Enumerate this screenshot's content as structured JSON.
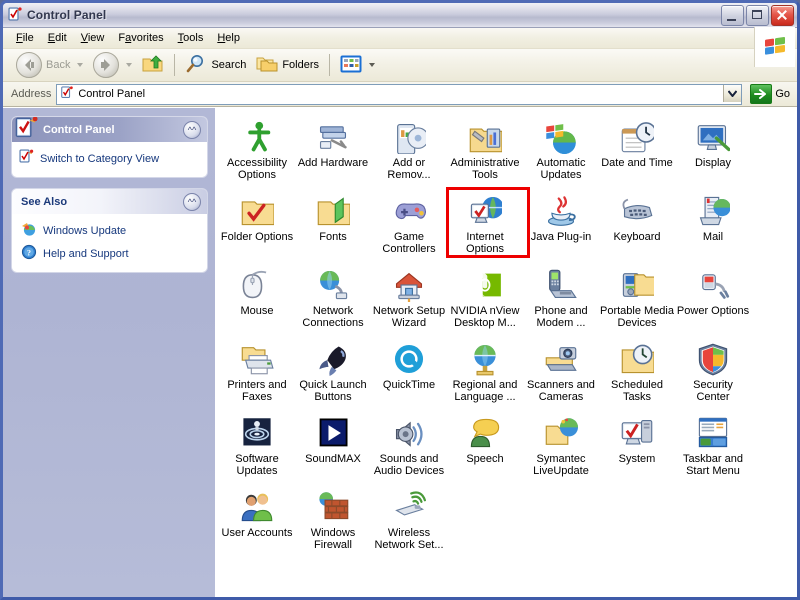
{
  "window": {
    "title": "Control Panel",
    "title_icon": "control-panel-icon",
    "buttons": {
      "minimize": "Minimize",
      "maximize": "Maximize",
      "close": "Close"
    }
  },
  "menubar": {
    "items": [
      {
        "label": "File",
        "accel": "F"
      },
      {
        "label": "Edit",
        "accel": "E"
      },
      {
        "label": "View",
        "accel": "V"
      },
      {
        "label": "Favorites",
        "accel": "a"
      },
      {
        "label": "Tools",
        "accel": "T"
      },
      {
        "label": "Help",
        "accel": "H"
      }
    ],
    "brand_icon": "windows-flag-icon"
  },
  "toolbar": {
    "back_label": "Back",
    "back_icon": "back-arrow-icon",
    "back_disabled": true,
    "forward_icon": "forward-arrow-icon",
    "forward_disabled": true,
    "up_icon": "up-folder-icon",
    "search_label": "Search",
    "search_icon": "magnifier-icon",
    "folders_label": "Folders",
    "folders_icon": "folders-icon",
    "views_icon": "views-icon"
  },
  "address": {
    "label": "Address",
    "value": "Control Panel",
    "icon": "control-panel-icon",
    "dropdown_icon": "chevron-down-icon",
    "go_label": "Go",
    "go_icon": "go-arrow-icon"
  },
  "sidebar": {
    "panels": [
      {
        "title": "Control Panel",
        "style": "blue",
        "head_icon": "control-panel-icon",
        "collapse_icon": "chevron-up-icon",
        "links": [
          {
            "label": "Switch to Category View",
            "icon": "category-view-icon"
          }
        ]
      },
      {
        "title": "See Also",
        "style": "white",
        "collapse_icon": "chevron-up-icon",
        "links": [
          {
            "label": "Windows Update",
            "icon": "windows-update-icon"
          },
          {
            "label": "Help and Support",
            "icon": "help-icon"
          }
        ]
      }
    ]
  },
  "main": {
    "selected_item": "Internet Options",
    "selection_color": "#ee0000",
    "items": [
      {
        "label": "Accessibility Options",
        "icon": "accessibility-icon"
      },
      {
        "label": "Add Hardware",
        "icon": "add-hardware-icon"
      },
      {
        "label": "Add or Remov...",
        "icon": "add-remove-programs-icon"
      },
      {
        "label": "Administrative Tools",
        "icon": "administrative-tools-icon"
      },
      {
        "label": "Automatic Updates",
        "icon": "automatic-updates-icon"
      },
      {
        "label": "Date and Time",
        "icon": "date-time-icon"
      },
      {
        "label": "Display",
        "icon": "display-icon"
      },
      {
        "label": "Folder Options",
        "icon": "folder-options-icon"
      },
      {
        "label": "Fonts",
        "icon": "fonts-icon"
      },
      {
        "label": "Game Controllers",
        "icon": "game-controllers-icon"
      },
      {
        "label": "Internet Options",
        "icon": "internet-options-icon"
      },
      {
        "label": "Java Plug-in",
        "icon": "java-icon"
      },
      {
        "label": "Keyboard",
        "icon": "keyboard-icon"
      },
      {
        "label": "Mail",
        "icon": "mail-icon"
      },
      {
        "label": "Mouse",
        "icon": "mouse-icon"
      },
      {
        "label": "Network Connections",
        "icon": "network-connections-icon"
      },
      {
        "label": "Network Setup Wizard",
        "icon": "network-setup-icon"
      },
      {
        "label": "NVIDIA nView Desktop M...",
        "icon": "nvidia-icon"
      },
      {
        "label": "Phone and Modem ...",
        "icon": "phone-modem-icon"
      },
      {
        "label": "Portable Media Devices",
        "icon": "portable-media-icon"
      },
      {
        "label": "Power Options",
        "icon": "power-options-icon"
      },
      {
        "label": "Printers and Faxes",
        "icon": "printers-faxes-icon"
      },
      {
        "label": "Quick Launch Buttons",
        "icon": "quick-launch-icon"
      },
      {
        "label": "QuickTime",
        "icon": "quicktime-icon"
      },
      {
        "label": "Regional and Language ...",
        "icon": "regional-language-icon"
      },
      {
        "label": "Scanners and Cameras",
        "icon": "scanners-cameras-icon"
      },
      {
        "label": "Scheduled Tasks",
        "icon": "scheduled-tasks-icon"
      },
      {
        "label": "Security Center",
        "icon": "security-center-icon"
      },
      {
        "label": "Software Updates",
        "icon": "software-updates-icon"
      },
      {
        "label": "SoundMAX",
        "icon": "soundmax-icon"
      },
      {
        "label": "Sounds and Audio Devices",
        "icon": "sounds-audio-icon"
      },
      {
        "label": "Speech",
        "icon": "speech-icon"
      },
      {
        "label": "Symantec LiveUpdate",
        "icon": "symantec-liveupdate-icon"
      },
      {
        "label": "System",
        "icon": "system-icon"
      },
      {
        "label": "Taskbar and Start Menu",
        "icon": "taskbar-start-menu-icon"
      },
      {
        "label": "User Accounts",
        "icon": "user-accounts-icon"
      },
      {
        "label": "Windows Firewall",
        "icon": "windows-firewall-icon"
      },
      {
        "label": "Wireless Network Set...",
        "icon": "wireless-network-icon"
      }
    ]
  }
}
